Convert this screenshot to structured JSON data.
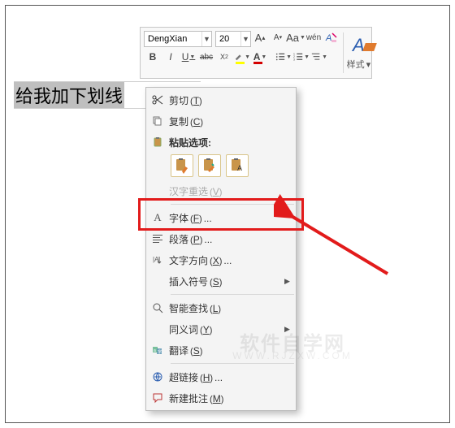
{
  "ribbon": {
    "font_name": "DengXian",
    "font_size": "20",
    "grow": "A",
    "shrink": "A",
    "change_case": "Aa",
    "phonetic": "wén",
    "bold": "B",
    "italic": "I",
    "underline": "U",
    "strike": "abc",
    "sub": "X",
    "sup": "X",
    "styles_glyph": "A",
    "styles_label": "样式"
  },
  "doc": {
    "selected_text": "给我加下划线"
  },
  "menu": {
    "cut": {
      "label": "剪切",
      "mn": "T"
    },
    "copy": {
      "label": "复制",
      "mn": "C"
    },
    "paste_hdr": {
      "label": "粘贴选项:"
    },
    "reconvert": {
      "label": "汉字重选",
      "mn": "V"
    },
    "font": {
      "label": "字体",
      "mn": "F",
      "suffix": "..."
    },
    "paragraph": {
      "label": "段落",
      "mn": "P",
      "suffix": "..."
    },
    "textdir": {
      "label": "文字方向",
      "mn": "X",
      "suffix": "..."
    },
    "symbol": {
      "label": "插入符号",
      "mn": "S"
    },
    "smartlookup": {
      "label": "智能查找",
      "mn": "L"
    },
    "synonyms": {
      "label": "同义词",
      "mn": "Y"
    },
    "translate": {
      "label": "翻译",
      "mn": "S"
    },
    "hyperlink": {
      "label": "超链接",
      "mn": "H",
      "suffix": "..."
    },
    "comment": {
      "label": "新建批注",
      "mn": "M"
    }
  },
  "watermark": {
    "line1": "软件自学网",
    "line2": "WWW.RJZXW.COM"
  }
}
